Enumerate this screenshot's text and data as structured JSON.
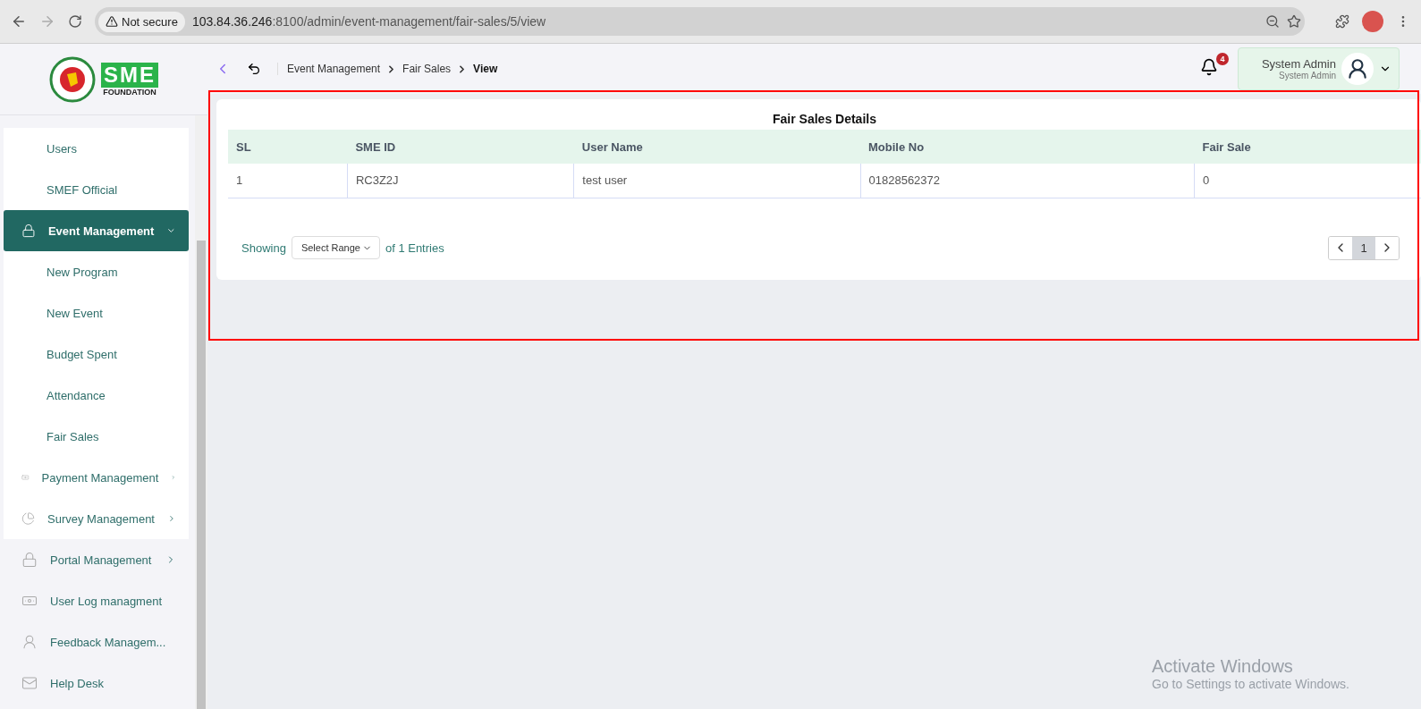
{
  "browser": {
    "security": "Not secure",
    "url_host": "103.84.36.246",
    "url_rest": ":8100/admin/event-management/fair-sales/5/view"
  },
  "header": {
    "breadcrumb": [
      {
        "label": "Event Management",
        "current": false
      },
      {
        "label": "Fair Sales",
        "current": false
      },
      {
        "label": "View",
        "current": true
      }
    ],
    "notifications": "4",
    "user": {
      "name": "System Admin",
      "role": "System Admin"
    }
  },
  "logo": {
    "text": "SME",
    "subtext": "FOUNDATION"
  },
  "sidebar": {
    "items": [
      {
        "label": "Users",
        "kind": "sub",
        "selected": false
      },
      {
        "label": "SMEF Official",
        "kind": "sub",
        "selected": false
      },
      {
        "label": "Event Management",
        "kind": "group",
        "selected": true,
        "expanded": true,
        "children": [
          {
            "label": "New Program",
            "selected": false
          },
          {
            "label": "New Event",
            "selected": false
          },
          {
            "label": "Budget Spent",
            "selected": false
          },
          {
            "label": "Attendance",
            "selected": false
          },
          {
            "label": "Fair Sales",
            "selected": false
          }
        ]
      },
      {
        "label": "Payment Management",
        "kind": "group",
        "selected": false,
        "expanded": false
      },
      {
        "label": "Survey Management",
        "kind": "group",
        "selected": false,
        "expanded": false
      },
      {
        "label": "Portal Management",
        "kind": "group",
        "selected": false,
        "expanded": false
      },
      {
        "label": "User Log managment",
        "kind": "link",
        "selected": false
      },
      {
        "label": "Feedback Managem...",
        "kind": "link",
        "selected": false
      },
      {
        "label": "Help Desk",
        "kind": "link",
        "selected": false
      }
    ]
  },
  "card": {
    "title": "Fair Sales Details",
    "table": {
      "columns": [
        "SL",
        "SME ID",
        "User Name",
        "Mobile No",
        "Fair Sale"
      ],
      "rows": [
        [
          "1",
          "RC3Z2J",
          "test user",
          "01828562372",
          "0"
        ]
      ]
    },
    "footer": {
      "showing": "Showing",
      "range": "Select Range",
      "entries": "of 1 Entries",
      "pages": [
        {
          "label": "1",
          "selected": true
        }
      ]
    }
  },
  "watermark": {
    "title": "Activate Windows",
    "text": "Go to Settings to activate Windows."
  }
}
